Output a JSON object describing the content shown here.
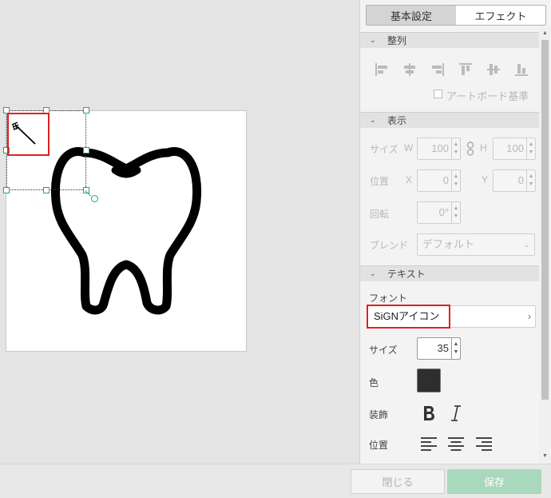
{
  "tabs": [
    "基本設定",
    "エフェクト"
  ],
  "sections": {
    "align": "整列",
    "display": "表示",
    "text": "テキスト"
  },
  "align_options": {
    "artboard_basis": "アートボード基準"
  },
  "display": {
    "size_label": "サイズ",
    "w_label": "W",
    "w_value": "100",
    "h_label": "H",
    "h_value": "100",
    "pos_label": "位置",
    "x_label": "X",
    "x_value": "0",
    "y_label": "Y",
    "y_value": "0",
    "rotate_label": "回転",
    "rotate_value": "0°",
    "blend_label": "ブレンド",
    "blend_value": "デフォルト"
  },
  "text": {
    "font_label": "フォント",
    "font_value": "SiGNアイコン",
    "size_label": "サイズ",
    "size_value": "35",
    "color_label": "色",
    "color_value": "#2e2e2e",
    "decor_label": "装飾",
    "position_label": "位置"
  },
  "footer": {
    "close": "閉じる",
    "save": "保存"
  },
  "colors": {
    "accent": "#2aa66a",
    "highlight": "#e02020",
    "save": "#a9d8bd"
  }
}
